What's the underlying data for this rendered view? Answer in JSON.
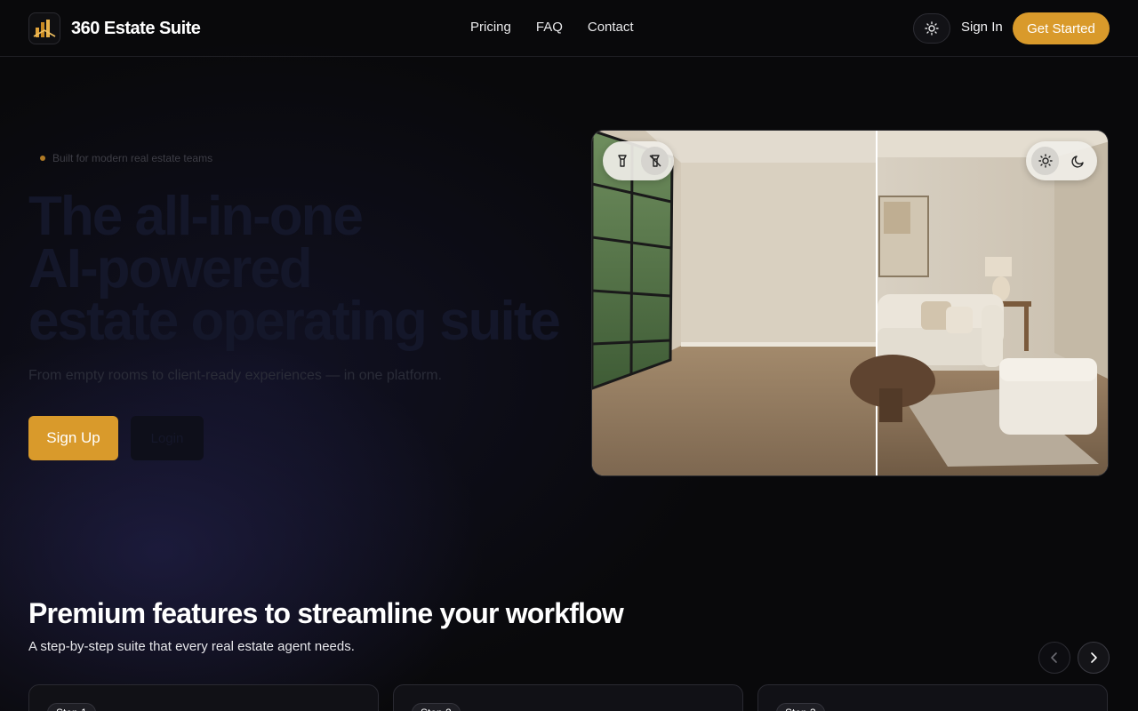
{
  "header": {
    "brand_name": "360 Estate Suite",
    "logo_icon": "building-logo-icon",
    "nav": [
      {
        "label": "Pricing"
      },
      {
        "label": "FAQ"
      },
      {
        "label": "Contact"
      }
    ],
    "theme_toggle_icon": "sun-icon",
    "sign_in_label": "Sign In",
    "get_started_label": "Get Started"
  },
  "hero": {
    "eyebrow": "Built for modern real estate teams",
    "headline_lines": [
      "The all-in-one",
      "AI-powered",
      "estate operating suite"
    ],
    "subhead": "From empty rooms to client-ready experiences — in one platform.",
    "signup_label": "Sign Up",
    "login_label": "Login"
  },
  "compare": {
    "left_controls": [
      {
        "icon": "lamp-icon",
        "active": false
      },
      {
        "icon": "lamp-off-icon",
        "active": true
      }
    ],
    "right_controls": [
      {
        "icon": "sun-icon",
        "active": true
      },
      {
        "icon": "moon-icon",
        "active": false
      }
    ]
  },
  "features": {
    "title": "Premium features to streamline your workflow",
    "subtitle": "A step-by-step suite that every real estate agent needs.",
    "prev_icon": "chevron-left-icon",
    "next_icon": "chevron-right-icon",
    "cards": [
      {
        "step": "Step 1"
      },
      {
        "step": "Step 2"
      },
      {
        "step": "Step 3"
      }
    ]
  },
  "colors": {
    "accent": "#d99a2b",
    "background": "#09090b"
  }
}
